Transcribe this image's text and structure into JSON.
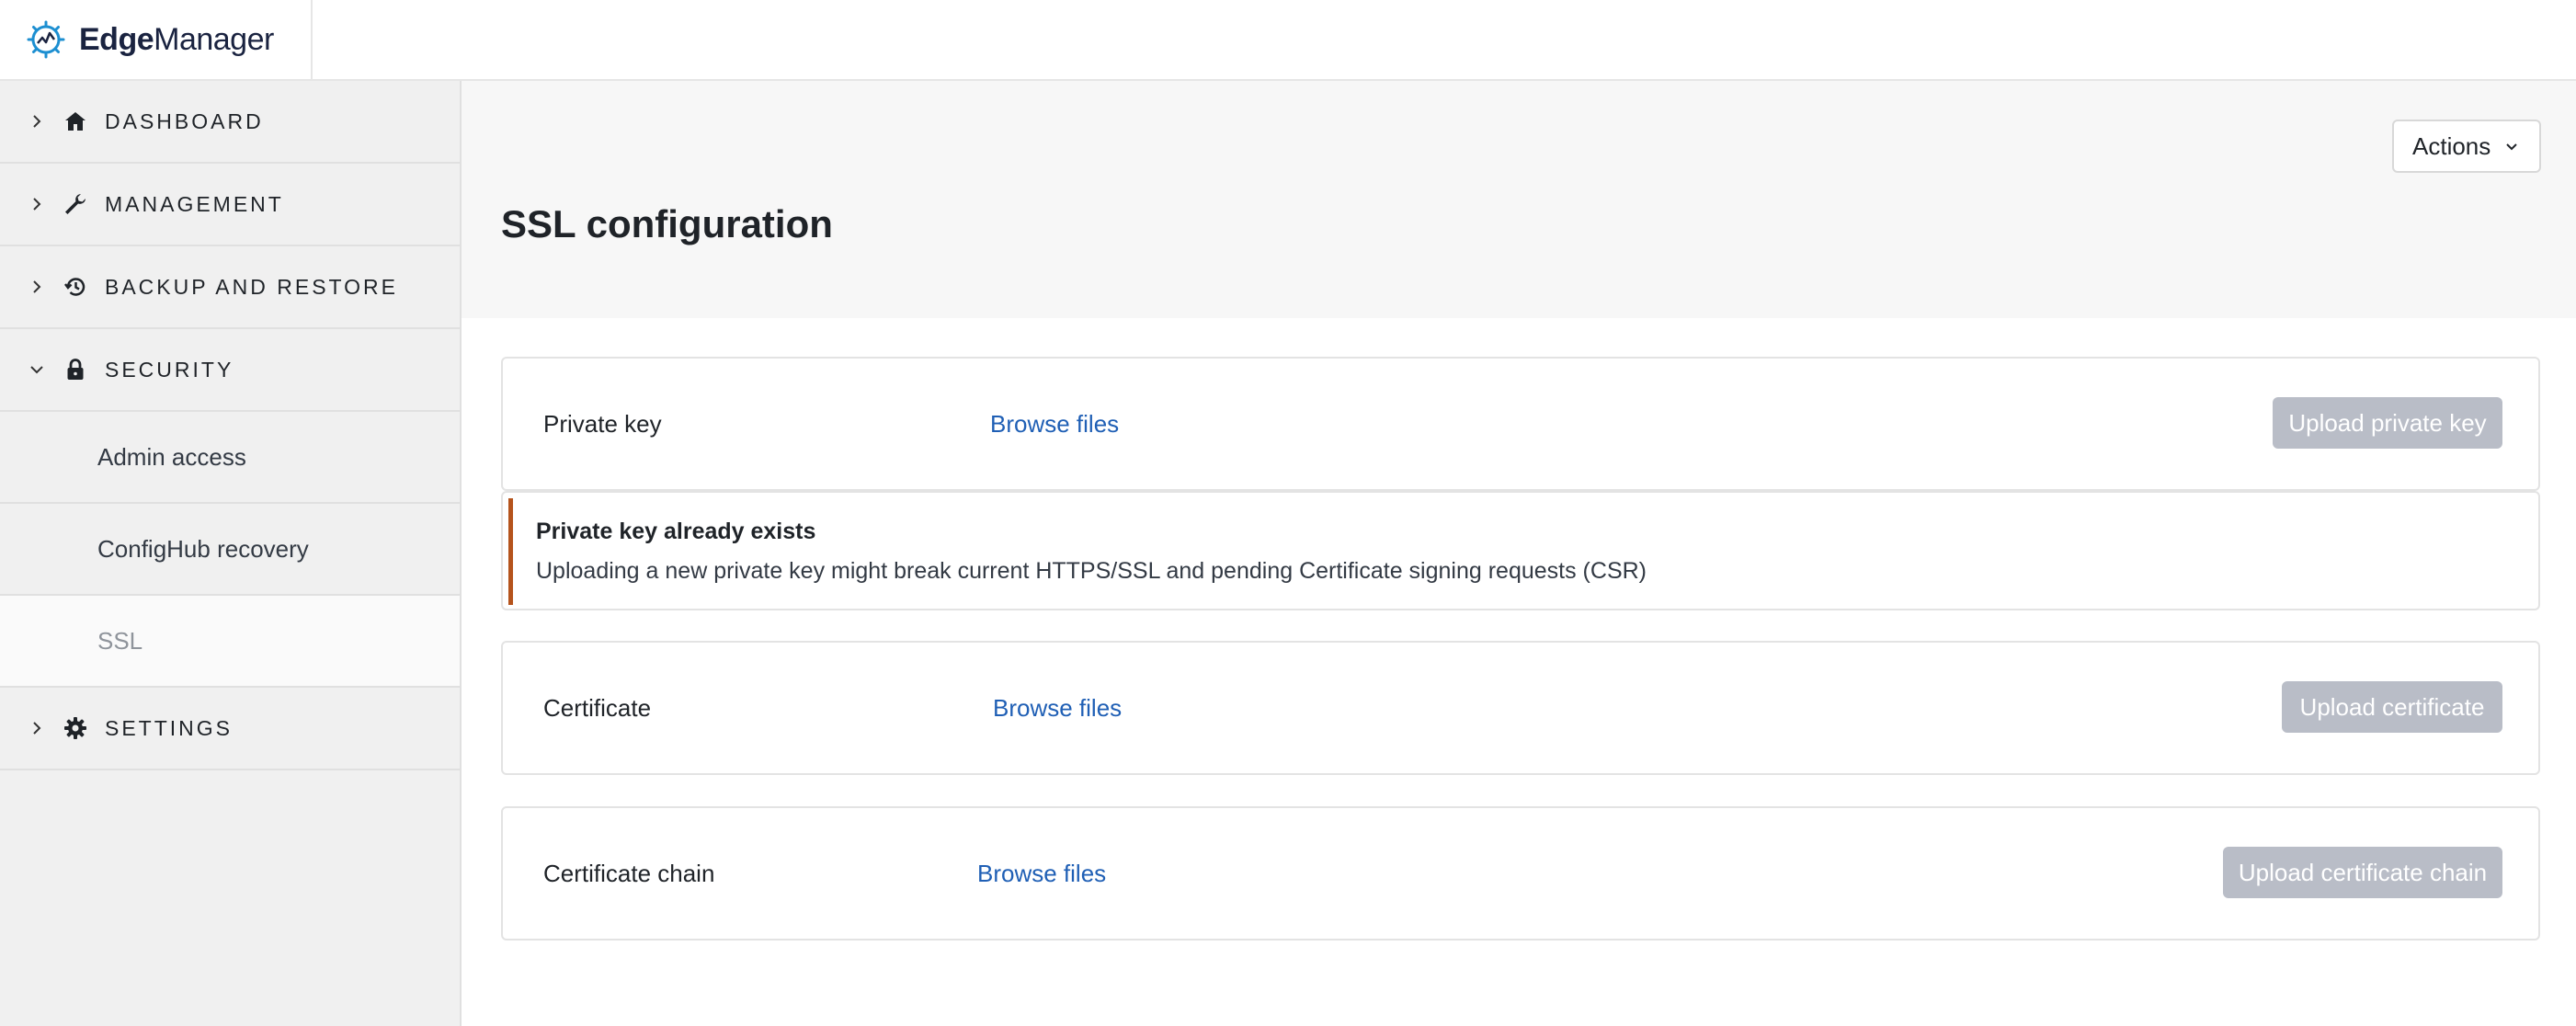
{
  "brand": {
    "name_bold": "Edge",
    "name_rest": "Manager"
  },
  "sidebar": {
    "items": [
      {
        "label": "DASHBOARD",
        "icon": "home-icon"
      },
      {
        "label": "MANAGEMENT",
        "icon": "wrench-icon"
      },
      {
        "label": "BACKUP AND RESTORE",
        "icon": "history-icon"
      },
      {
        "label": "SECURITY",
        "icon": "lock-icon",
        "expanded": true,
        "children": [
          "Admin access",
          "ConfigHub recovery",
          "SSL"
        ]
      },
      {
        "label": "SETTINGS",
        "icon": "gear-icon"
      }
    ]
  },
  "header": {
    "title": "SSL configuration",
    "actions_label": "Actions"
  },
  "cards": {
    "private_key": {
      "label": "Private key",
      "browse": "Browse files",
      "upload": "Upload private key"
    },
    "certificate": {
      "label": "Certificate",
      "browse": "Browse files",
      "upload": "Upload certificate"
    },
    "certificate_chain": {
      "label": "Certificate chain",
      "browse": "Browse files",
      "upload": "Upload certificate chain"
    }
  },
  "warning": {
    "title": "Private key already exists",
    "text": "Uploading a new private key might break current HTTPS/SSL and pending Certificate signing requests (CSR)"
  },
  "colors": {
    "link": "#1f5fb5",
    "disabled_button": "#b9bdc7",
    "warning_accent": "#b5531c"
  }
}
